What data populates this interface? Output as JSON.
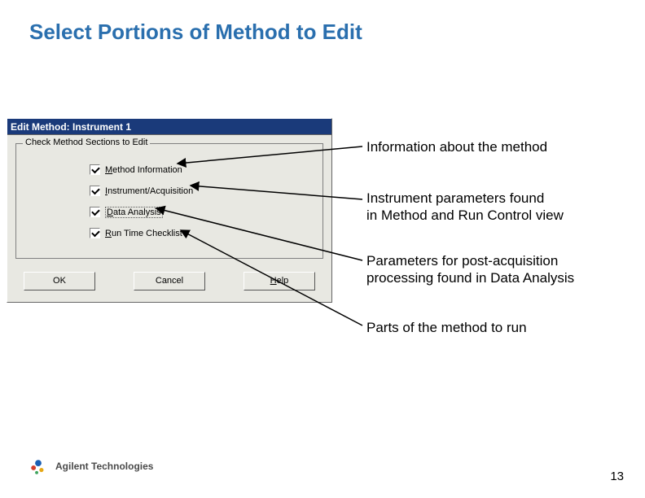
{
  "slide": {
    "title": "Select Portions of Method to Edit",
    "page_number": "13"
  },
  "dialog": {
    "title": "Edit Method: Instrument 1",
    "group_legend": "Check Method Sections to Edit",
    "checkboxes": [
      {
        "prefix": "M",
        "rest": "ethod Information",
        "checked": true
      },
      {
        "prefix": "I",
        "rest": "nstrument/Acquisition",
        "checked": true
      },
      {
        "prefix": "D",
        "rest": "ata Analysis",
        "checked": true,
        "selected": true
      },
      {
        "prefix": "R",
        "rest": "un Time Checklist",
        "checked": true
      }
    ],
    "buttons": {
      "ok": "OK",
      "cancel": "Cancel",
      "help_prefix": "H",
      "help_rest": "elp"
    }
  },
  "annotations": {
    "a1": "Information about the method",
    "a2": "Instrument parameters found\nin Method and Run Control view",
    "a3": "Parameters for post-acquisition\nprocessing found in Data Analysis",
    "a4": "Parts of the method to run"
  },
  "footer": {
    "brand": "Agilent Technologies"
  }
}
